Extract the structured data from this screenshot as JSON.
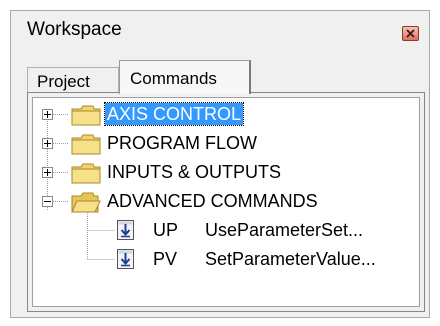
{
  "window": {
    "title": "Workspace",
    "close_icon": "close-x-icon",
    "close_color": "#d9735c"
  },
  "tabs": [
    {
      "label": "Project",
      "active": false
    },
    {
      "label": "Commands",
      "active": true
    }
  ],
  "tree": {
    "selection_color": "#3399ff",
    "folders": [
      {
        "label": "AXIS CONTROL",
        "expanded": false,
        "selected": true,
        "icon": "folder-closed-icon"
      },
      {
        "label": "PROGRAM FLOW",
        "expanded": false,
        "selected": false,
        "icon": "folder-closed-icon"
      },
      {
        "label": "INPUTS & OUTPUTS",
        "expanded": false,
        "selected": false,
        "icon": "folder-closed-icon"
      },
      {
        "label": "ADVANCED COMMANDS",
        "expanded": true,
        "selected": false,
        "icon": "folder-open-icon",
        "children": [
          {
            "code": "UP",
            "name": "UseParameterSet...",
            "icon": "download-command-icon"
          },
          {
            "code": "PV",
            "name": "SetParameterValue...",
            "icon": "download-command-icon"
          }
        ]
      }
    ]
  }
}
